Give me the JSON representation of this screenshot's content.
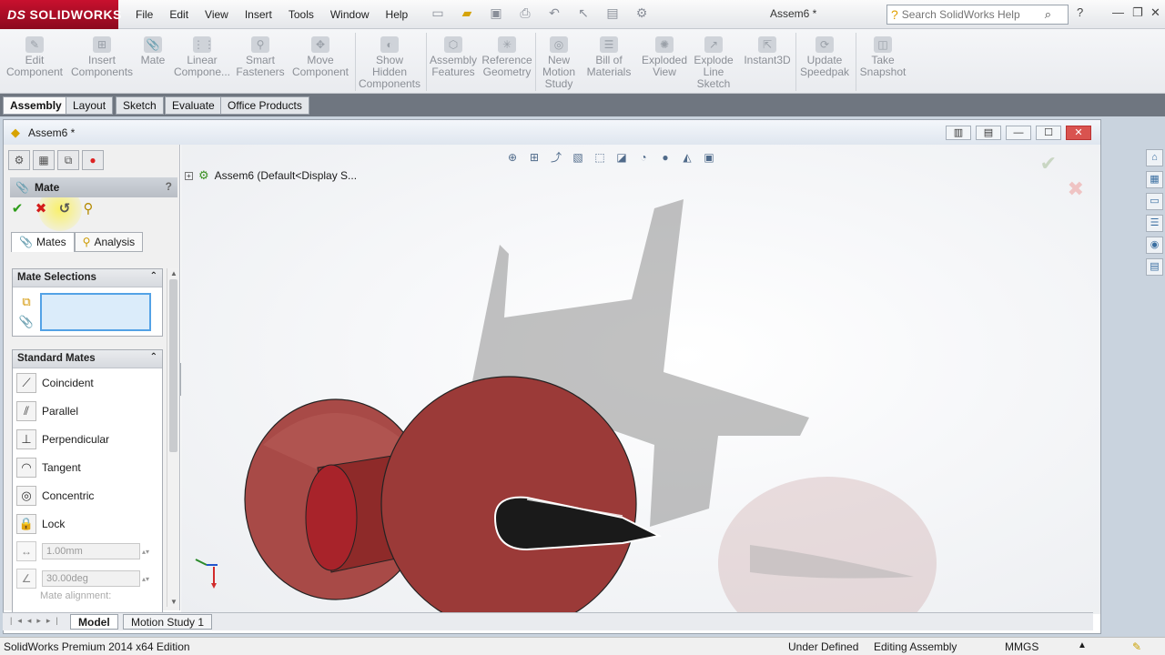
{
  "app": {
    "logo_text": "SOLIDWORKS",
    "document_title": "Assem6 *",
    "menu": [
      "File",
      "Edit",
      "View",
      "Insert",
      "Tools",
      "Window",
      "Help"
    ],
    "search_placeholder": "Search SolidWorks Help"
  },
  "command_manager": {
    "buttons": [
      {
        "label": "Edit\nComponent",
        "icon": "edit-component-icon"
      },
      {
        "label": "Insert\nComponents",
        "icon": "insert-components-icon"
      },
      {
        "label": "Mate",
        "icon": "mate-icon"
      },
      {
        "label": "Linear\nCompone...",
        "icon": "linear-pattern-icon"
      },
      {
        "label": "Smart\nFasteners",
        "icon": "smart-fasteners-icon"
      },
      {
        "label": "Move\nComponent",
        "icon": "move-component-icon"
      },
      {
        "label": "Show\nHidden\nComponents",
        "icon": "show-hidden-icon"
      },
      {
        "label": "Assembly\nFeatures",
        "icon": "assembly-features-icon"
      },
      {
        "label": "Reference\nGeometry",
        "icon": "reference-geometry-icon"
      },
      {
        "label": "New\nMotion\nStudy",
        "icon": "motion-study-icon"
      },
      {
        "label": "Bill of\nMaterials",
        "icon": "bom-icon"
      },
      {
        "label": "Exploded\nView",
        "icon": "exploded-view-icon"
      },
      {
        "label": "Explode\nLine\nSketch",
        "icon": "explode-line-icon"
      },
      {
        "label": "Instant3D",
        "icon": "instant3d-icon"
      },
      {
        "label": "Update\nSpeedpak",
        "icon": "speedpak-icon"
      },
      {
        "label": "Take\nSnapshot",
        "icon": "snapshot-icon"
      }
    ],
    "tabs": [
      "Assembly",
      "Layout",
      "Sketch",
      "Evaluate",
      "Office Products"
    ],
    "active_tab": "Assembly"
  },
  "document": {
    "title": "Assem6 *"
  },
  "property_manager": {
    "title": "Mate",
    "help": "?",
    "subtabs": [
      "Mates",
      "Analysis"
    ],
    "mate_selections_header": "Mate Selections",
    "standard_mates_header": "Standard Mates",
    "standard_mates": [
      "Coincident",
      "Parallel",
      "Perpendicular",
      "Tangent",
      "Concentric",
      "Lock"
    ],
    "distance_value": "1.00mm",
    "angle_value": "30.00deg",
    "mate_alignment_label": "Mate alignment:"
  },
  "viewport": {
    "tree_node_label": "Assem6  (Default<Display S..."
  },
  "bottom_tabs": [
    "Model",
    "Motion Study 1"
  ],
  "status_bar": {
    "edition": "SolidWorks Premium 2014 x64 Edition",
    "status": "Under Defined",
    "mode": "Editing Assembly",
    "units": "MMGS"
  },
  "colors": {
    "pushpin_red": "#9b3a38",
    "pin_needle": "#1a1a1a",
    "ok_green": "#2d9c18",
    "cancel_red": "#d31b1b",
    "selection_blue": "#53a2e6"
  }
}
